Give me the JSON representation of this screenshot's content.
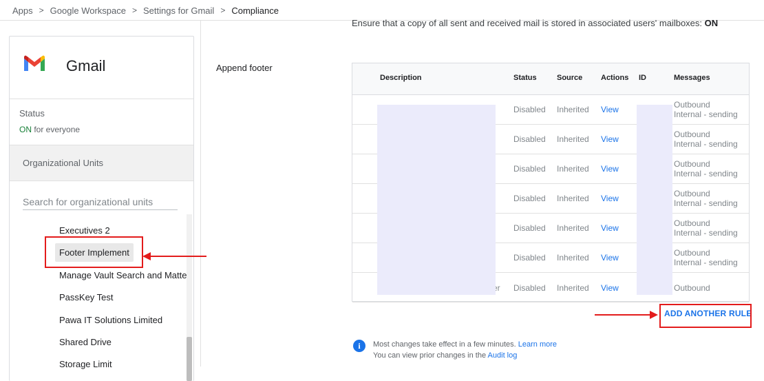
{
  "breadcrumb": {
    "items": [
      "Apps",
      "Google Workspace",
      "Settings for Gmail",
      "Compliance"
    ],
    "separator": ">"
  },
  "app": {
    "name": "Gmail",
    "icon": "gmail-logo-icon"
  },
  "status": {
    "label": "Status",
    "value_on": "ON",
    "value_rest": "for everyone"
  },
  "org_units": {
    "title": "Organizational Units",
    "search_placeholder": "Search for organizational units",
    "items": [
      "Executives 2",
      "Footer Implement",
      "Manage Vault Search and Matter",
      "PassKey Test",
      "Pawa IT Solutions Limited",
      "Shared Drive",
      "Storage Limit"
    ],
    "selected": "Footer Implement"
  },
  "setting": {
    "description": "Ensure that a copy of all sent and received mail is stored in associated users' mailboxes:",
    "value": "ON"
  },
  "append_footer": {
    "label": "Append footer",
    "columns": [
      "Description",
      "Status",
      "Source",
      "Actions",
      "ID",
      "Messages"
    ],
    "rows": [
      {
        "status": "Disabled",
        "source": "Inherited",
        "action": "View",
        "messages": [
          "Outbound",
          "Internal - sending"
        ]
      },
      {
        "status": "Disabled",
        "source": "Inherited",
        "action": "View",
        "messages": [
          "Outbound",
          "Internal - sending"
        ]
      },
      {
        "status": "Disabled",
        "source": "Inherited",
        "action": "View",
        "messages": [
          "Outbound",
          "Internal - sending"
        ]
      },
      {
        "status": "Disabled",
        "source": "Inherited",
        "action": "View",
        "messages": [
          "Outbound",
          "Internal - sending"
        ]
      },
      {
        "status": "Disabled",
        "source": "Inherited",
        "action": "View",
        "messages": [
          "Outbound",
          "Internal - sending"
        ]
      },
      {
        "status": "Disabled",
        "source": "Inherited",
        "action": "View",
        "messages": [
          "Outbound",
          "Internal - sending"
        ]
      },
      {
        "status": "Disabled",
        "source": "Inherited",
        "action": "View",
        "messages": [
          "Outbound"
        ],
        "desc_tail": "er"
      }
    ],
    "add_rule_label": "ADD ANOTHER RULE"
  },
  "info": {
    "line1": "Most changes take effect in a few minutes.",
    "line1_link": "Learn more",
    "line2": "You can view prior changes in the",
    "line2_link": "Audit log"
  },
  "colors": {
    "accent": "#1a73e8",
    "on_green": "#188038",
    "annotation_red": "#e31b1b",
    "redaction": "#ebebfb"
  }
}
